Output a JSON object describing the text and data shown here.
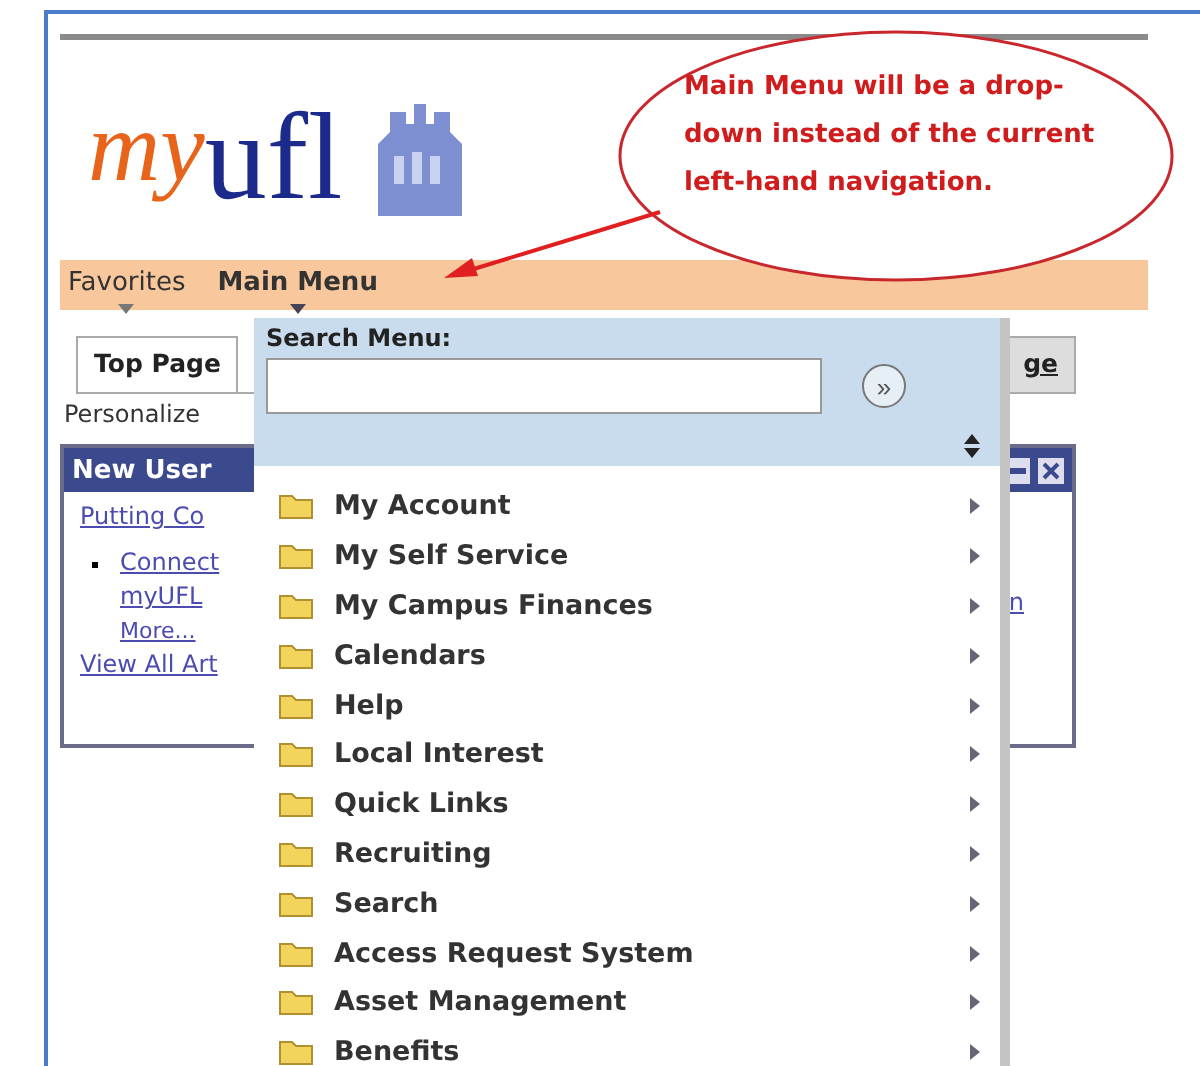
{
  "logo": {
    "prefix": "my",
    "name": "ufl"
  },
  "menubar": {
    "items": [
      {
        "label": "Favorites",
        "selected": false
      },
      {
        "label": "Main Menu",
        "selected": true
      }
    ]
  },
  "tabs": [
    {
      "label": "Top Page",
      "selected": true
    },
    {
      "label": "ge",
      "selected": false
    }
  ],
  "personalize": "Personalize",
  "panel": {
    "title": "New User",
    "links": [
      {
        "label": "Putting Co",
        "kind": "heading"
      },
      {
        "label": "Connect",
        "kind": "bullet"
      },
      {
        "label": "myUFL",
        "kind": "plain"
      },
      {
        "label": "More...",
        "kind": "more"
      },
      {
        "label": "View All Art",
        "kind": "heading"
      }
    ],
    "side_link": "n"
  },
  "dropdown": {
    "label": "Search Menu:",
    "go": "»",
    "items": [
      {
        "label": "My Account"
      },
      {
        "label": "My Self Service"
      },
      {
        "label": "My Campus Finances"
      },
      {
        "label": "Calendars"
      },
      {
        "label": "Help"
      },
      {
        "label": "Local Interest"
      },
      {
        "label": "Quick Links"
      },
      {
        "label": "Recruiting"
      },
      {
        "label": "Search"
      },
      {
        "label": "Access Request System"
      },
      {
        "label": "Asset Management"
      },
      {
        "label": "Benefits"
      }
    ]
  },
  "callout": "Main Menu will be a drop-down instead of the current left-hand navigation."
}
